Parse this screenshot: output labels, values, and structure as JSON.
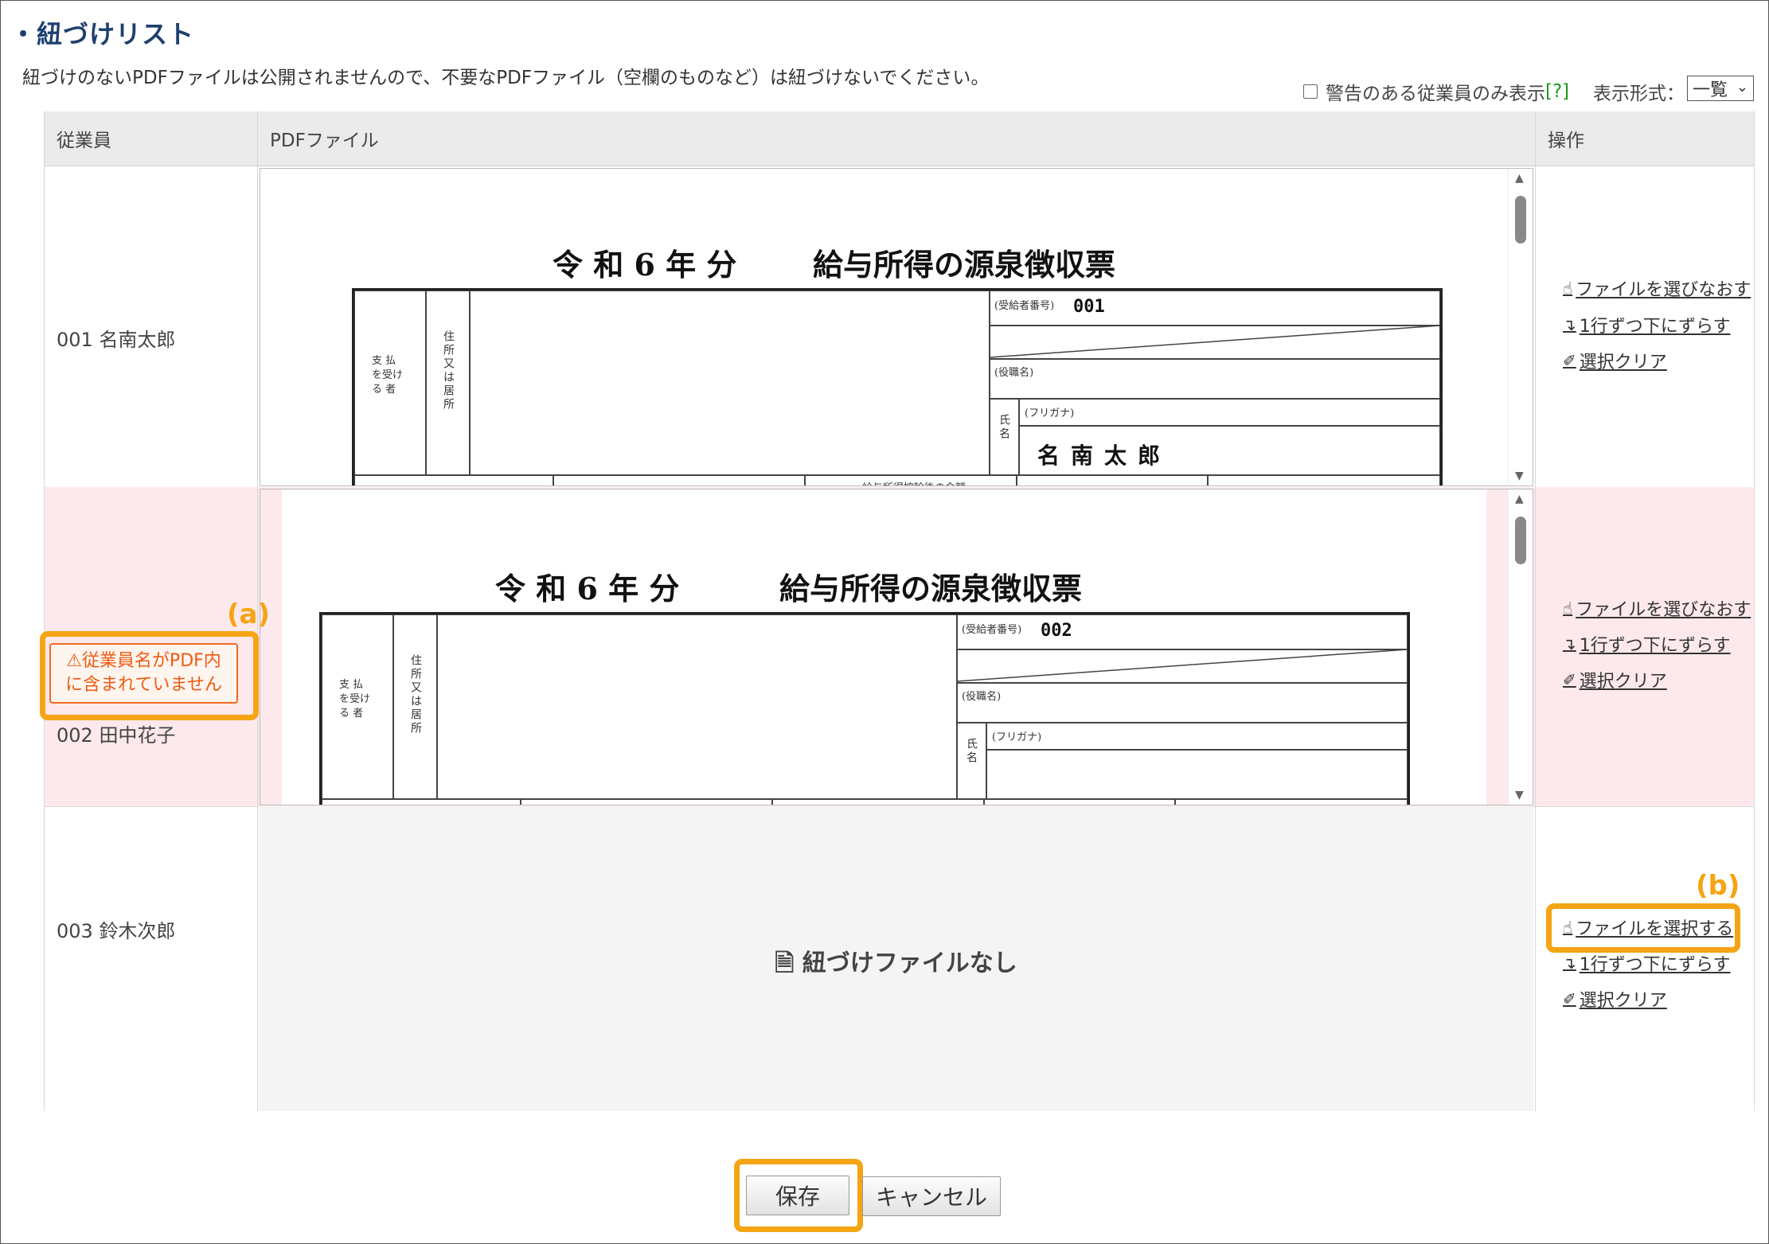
{
  "section_title": "・紐づけリスト",
  "notice": "紐づけのないPDFファイルは公開されませんので、不要なPDFファイル（空欄のものなど）は紐づけないでください。",
  "filter": {
    "label": "警告のある従業員のみ表示",
    "help": "[?]"
  },
  "view_mode": {
    "label": "表示形式：",
    "selected": "一覧"
  },
  "table": {
    "headers": {
      "employee": "従業員",
      "pdf": "PDFファイル",
      "ops": "操作"
    }
  },
  "pdf_common": {
    "title_year": "令 和 6 年 分",
    "title_main": "給与所得の源泉徴収票",
    "recipient_no_label": "(受給者番号)",
    "position_label": "(役職名)",
    "furigana_label": "(フリガナ)",
    "payee_label": "支 払\nを受け\nる 者",
    "address_label": "住所又は居所",
    "name_field_label": "氏名",
    "bottom_cut_text": "給与所得控除後の金額"
  },
  "rows": [
    {
      "employee": "001  名南太郎",
      "recipient_no": "001",
      "name": "名南太郎",
      "ops": [
        "ファイルを選びなおす",
        "1行ずつ下にずらす",
        "選択クリア"
      ]
    },
    {
      "employee": "002  田中花子",
      "recipient_no": "002",
      "name": "",
      "warning": "従業員名がPDF内\nに含まれていません",
      "ops": [
        "ファイルを選びなおす",
        "1行ずつ下にずらす",
        "選択クリア"
      ]
    },
    {
      "employee": "003  鈴木次郎",
      "no_file": "紐づけファイルなし",
      "ops": [
        "ファイルを選択する",
        "1行ずつ下にずらす",
        "選択クリア"
      ]
    }
  ],
  "callouts": {
    "a": "(a)",
    "b": "(b)"
  },
  "buttons": {
    "save": "保存",
    "cancel": "キャンセル"
  },
  "colors": {
    "highlight": "#f5a414",
    "warning": "#ee5a10",
    "warning_row_bg": "#fde9ec",
    "title": "#1e3f6e"
  }
}
